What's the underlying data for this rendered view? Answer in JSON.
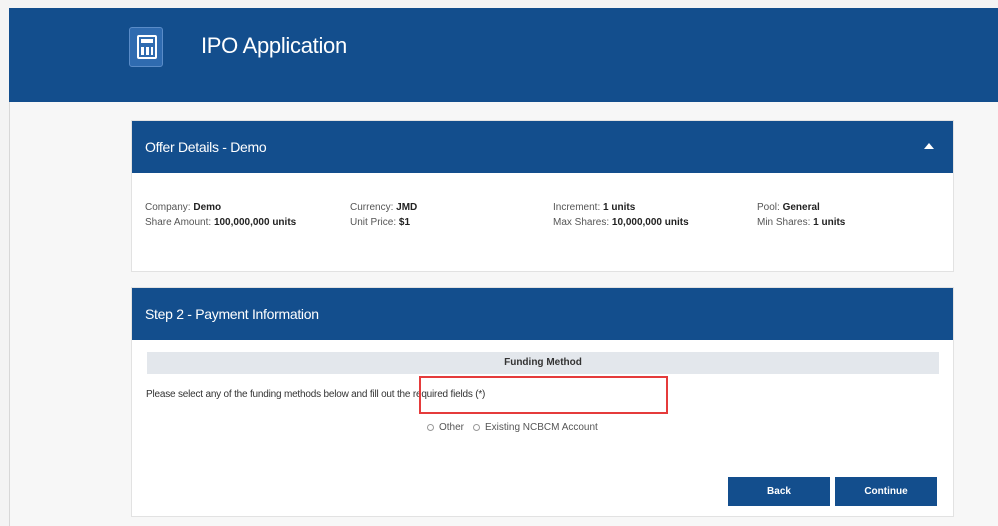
{
  "header": {
    "title": "IPO Application",
    "icon": "ipo-app-icon"
  },
  "offer_panel": {
    "title": "Offer Details - Demo",
    "toggle_icon": "chevron-up-icon",
    "details": [
      {
        "label": "Company:",
        "value": "Demo"
      },
      {
        "label": "Share Amount:",
        "value": "100,000,000 units"
      },
      {
        "label": "Currency:",
        "value": "JMD"
      },
      {
        "label": "Unit Price:",
        "value": "$1"
      },
      {
        "label": "Increment:",
        "value": "1 units"
      },
      {
        "label": "Max Shares:",
        "value": "10,000,000 units"
      },
      {
        "label": "Pool:",
        "value": "General"
      },
      {
        "label": "Min Shares:",
        "value": "1 units"
      }
    ]
  },
  "payment_panel": {
    "title": "Step 2 - Payment Information",
    "funding_header": "Funding Method",
    "instruction": "Please select any of the funding methods below and fill out the required fields (*)",
    "options": [
      "Other",
      "Existing NCBCM Account"
    ],
    "back_label": "Back",
    "continue_label": "Continue"
  },
  "colors": {
    "primary": "#134e8d",
    "highlight": "#e53b3b"
  }
}
